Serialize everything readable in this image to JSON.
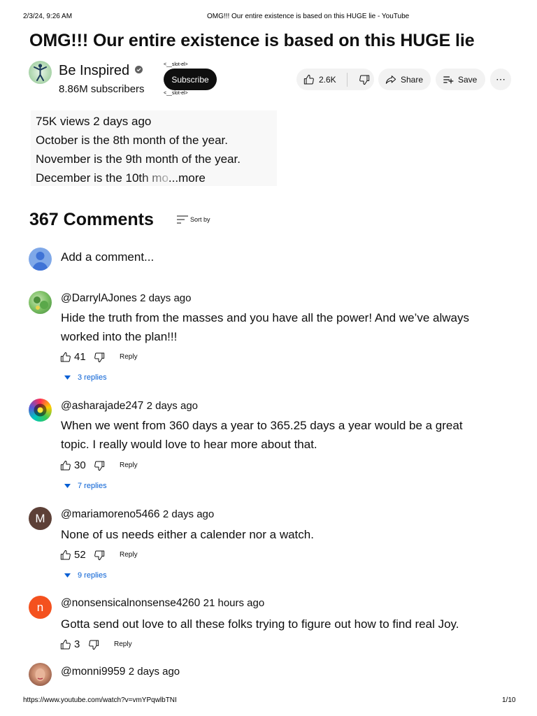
{
  "print_header": {
    "date": "2/3/24, 9:26 AM",
    "title": "OMG!!! Our entire existence is based on this HUGE lie - YouTube"
  },
  "video": {
    "title": "OMG!!! Our entire existence is based on this HUGE lie",
    "channel_name": "Be Inspired",
    "subscribers": "8.86M subscribers",
    "slot_top": "<__slot-el>",
    "slot_bottom": "<__slot-el>",
    "subscribe_label": "Subscribe",
    "likes": "2.6K",
    "share_label": "Share",
    "save_label": "Save",
    "more_label": "⋯"
  },
  "description": {
    "meta": "75K views  2 days ago",
    "line1": "October is the 8th month of the year.",
    "line2": "November is the 9th month of the year.",
    "line3_visible": "December is the 10th mo",
    "more": "...more"
  },
  "comments_header": {
    "count_label": "367 Comments",
    "sort_label": "Sort by"
  },
  "add_comment": {
    "placeholder": "Add a comment..."
  },
  "comments": [
    {
      "author": "@DarrylAJones",
      "time": "2 days ago",
      "text_line1": "Hide the truth from the masses and you have all the power!  And we’ve always",
      "text_line2": "worked into the plan!!!",
      "likes": "41",
      "reply_label": "Reply",
      "replies_label": "3 replies"
    },
    {
      "author": "@asharajade247",
      "time": "2 days ago",
      "text_line1": "When we went from 360 days a year to 365.25 days a year would be a great",
      "text_line2": "topic. I really would love to hear more about that.",
      "likes": "30",
      "reply_label": "Reply",
      "replies_label": "7 replies"
    },
    {
      "author": "@mariamoreno5466",
      "time": "2 days ago",
      "avatar_letter": "M",
      "avatar_color": "#5d4037",
      "text_line1": "None of us needs either a calender nor a watch.",
      "likes": "52",
      "reply_label": "Reply",
      "replies_label": "9 replies"
    },
    {
      "author": "@nonsensicalnonsense4260",
      "time": "21 hours ago",
      "avatar_letter": "n",
      "avatar_color": "#f4511e",
      "text_line1": "Gotta send out love to all these folks trying to figure out how to find real Joy.",
      "likes": "3",
      "reply_label": "Reply"
    },
    {
      "author": "@monni9959",
      "time": "2 days ago"
    }
  ],
  "print_footer": {
    "url": "https://www.youtube.com/watch?v=vmYPqwlbTNI",
    "page": "1/10"
  },
  "colors": {
    "link_blue": "#065fd4",
    "pill_bg": "#f2f2f2",
    "button_dark": "#0f0f0f"
  }
}
